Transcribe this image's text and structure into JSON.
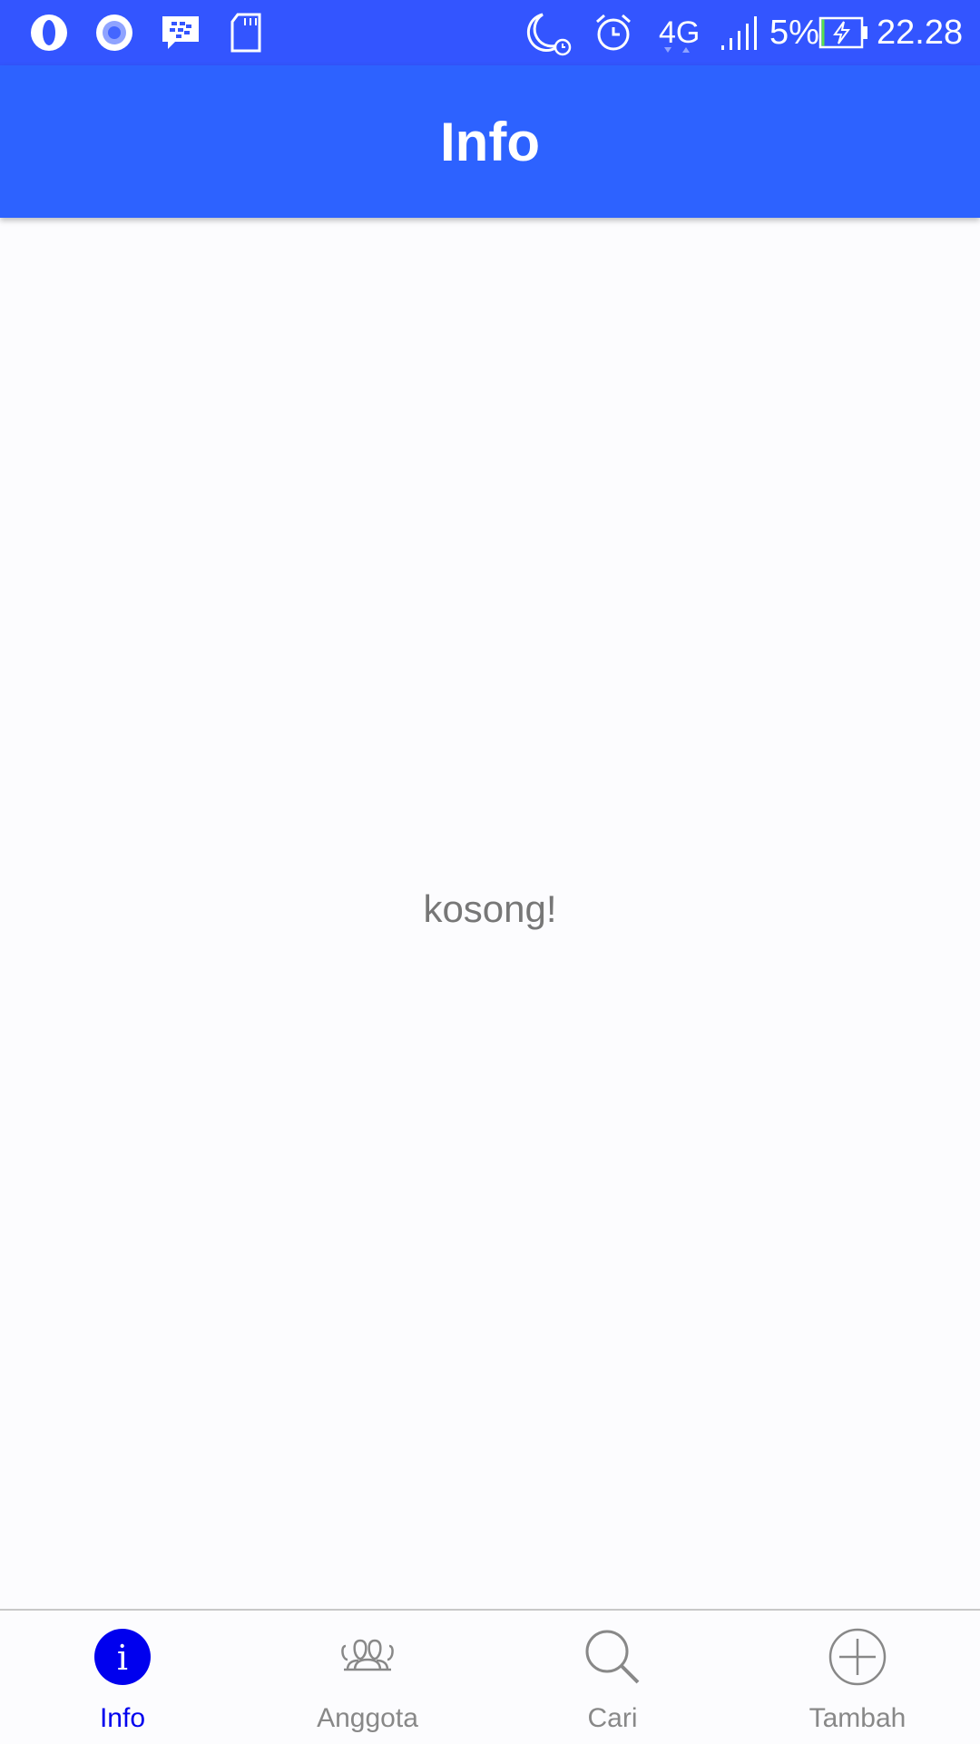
{
  "status_bar": {
    "icons": [
      "opera-icon",
      "browser-icon",
      "bbm-icon",
      "sd-card-icon",
      "night-mode-icon",
      "alarm-icon",
      "network-4g-icon",
      "signal-icon",
      "battery-charging-icon"
    ],
    "network": "4G",
    "battery": "5%",
    "time": "22.28"
  },
  "app_bar": {
    "title": "Info"
  },
  "content": {
    "empty_message": "kosong!"
  },
  "bottom_nav": {
    "active": "Info",
    "items": [
      {
        "label": "Info",
        "icon": "info-icon"
      },
      {
        "label": "Anggota",
        "icon": "members-icon"
      },
      {
        "label": "Cari",
        "icon": "search-icon"
      },
      {
        "label": "Tambah",
        "icon": "add-icon"
      }
    ]
  },
  "colors": {
    "status_bar": "#3355ff",
    "app_bar": "#2d62ff",
    "active_tab": "#0000ee",
    "inactive_tab": "#888888"
  }
}
